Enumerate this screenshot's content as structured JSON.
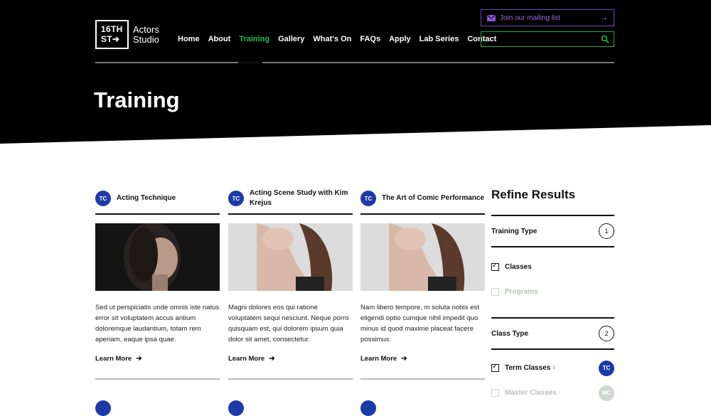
{
  "colors": {
    "accent_green": "#1fbf4a",
    "accent_purple": "#7b3fc4",
    "badge_blue": "#1d3aa8"
  },
  "logo": {
    "line1": "16TH",
    "line2": "ST",
    "arrow": "➔",
    "name_line1": "Actors",
    "name_line2": "Studio"
  },
  "nav": {
    "items": [
      {
        "label": "Home"
      },
      {
        "label": "About"
      },
      {
        "label": "Training",
        "active": true
      },
      {
        "label": "Gallery"
      },
      {
        "label": "What's On"
      },
      {
        "label": "FAQs"
      },
      {
        "label": "Apply"
      },
      {
        "label": "Lab Series"
      },
      {
        "label": "Contact"
      }
    ]
  },
  "mailing": {
    "label": "Join our mailing list",
    "icon": "mail-icon",
    "arrow": "→"
  },
  "search": {
    "value": "",
    "icon": "search-icon"
  },
  "page": {
    "title": "Training"
  },
  "cards": [
    {
      "badge": "TC",
      "title": "Acting Technique",
      "desc": "Sed ut perspiciatis unde omnis iste natus error sit voluptatem accus antium doloremque laudantium, totam rem aperiam, eaque ipsa quae.",
      "link": "Learn More",
      "arrow": "➔"
    },
    {
      "badge": "TC",
      "title": "Acting Scene Study with Kim Krejus",
      "desc": "Magni dolores eos qui ratione voluptatem sequi nesciunt. Neque porro quisquam est, qui dolorem ipsum quia dolor sit amet, consectetur.",
      "link": "Learn More",
      "arrow": "➔"
    },
    {
      "badge": "TC",
      "title": "The Art of Comic Performance",
      "desc": "Nam libero tempore, m soluta nobis est eligendi optio cumque nihil impedit quo minus id quod maxime placeat facere possimus.",
      "link": "Learn More",
      "arrow": "➔"
    }
  ],
  "refine": {
    "title": "Refine Results",
    "sections": [
      {
        "name": "Training Type",
        "number": "1",
        "options": [
          {
            "label": "Classes",
            "checked": true
          },
          {
            "label": "Programs",
            "checked": false
          }
        ]
      },
      {
        "name": "Class Type",
        "number": "2",
        "options": [
          {
            "label": "Term Classes",
            "checked": true,
            "sup": "i",
            "tag": "TC"
          },
          {
            "label": "Master Classes",
            "checked": false,
            "sup": "i",
            "tag": "MC"
          }
        ]
      }
    ]
  }
}
